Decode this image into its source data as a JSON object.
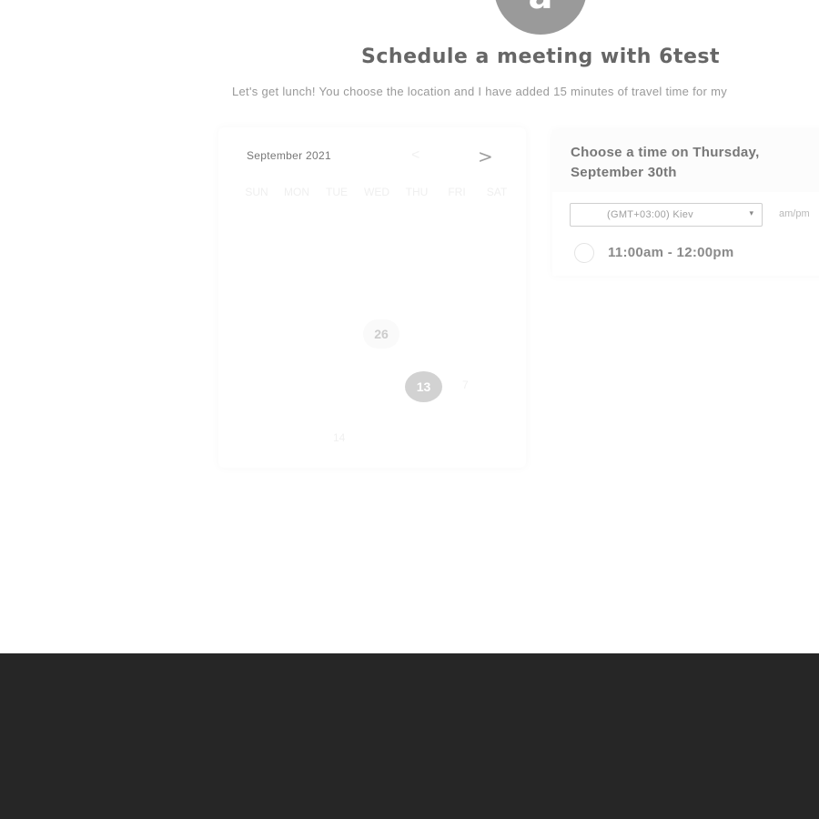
{
  "host": {
    "avatar_initial": "a",
    "title": "Schedule a meeting with 6test",
    "description": "Let's get lunch! You choose the location and I have added 15 minutes of travel time for my"
  },
  "calendar": {
    "month_label": "September 2021",
    "prev_icon": "chevron-left-icon",
    "next_icon": "chevron-right-icon",
    "prev_glyph": "<",
    "next_glyph": ">",
    "weekdays": [
      "SUN",
      "MON",
      "TUE",
      "WED",
      "THU",
      "FRI",
      "SAT"
    ],
    "highlighted_day": "26",
    "selected_day": "13",
    "faint_days": [
      "7",
      "14"
    ]
  },
  "time_picker": {
    "heading": "Choose a time on Thursday, September 30th",
    "timezone": "(GMT+03:00) Kiev",
    "timezone_caret": "▾",
    "format_toggle": "am/pm",
    "slots": [
      "11:00am - 12:00pm"
    ]
  },
  "colors": {
    "footer_band": "#262626",
    "avatar": "#9a9a9a",
    "selected_day": "#d2d2d2"
  }
}
